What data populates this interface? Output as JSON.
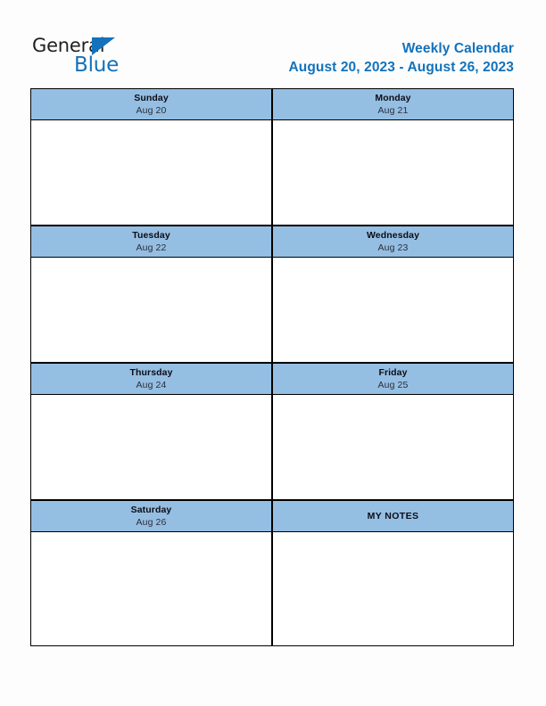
{
  "logo": {
    "word_dark": "General",
    "word_blue": "Blue",
    "triangle_icon": "triangle-icon",
    "brand_color": "#1372bb",
    "dark_color": "#231f20"
  },
  "header": {
    "title": "Weekly Calendar",
    "date_range": "August 20, 2023 - August 26, 2023",
    "title_color": "#1372bb"
  },
  "calendar": {
    "header_bg_color": "#95bee3",
    "border_color": "#000000",
    "cell_bg_color": "#ffffff",
    "rows": [
      {
        "left": {
          "day": "Sunday",
          "date": "Aug 20"
        },
        "right": {
          "day": "Monday",
          "date": "Aug 21"
        }
      },
      {
        "left": {
          "day": "Tuesday",
          "date": "Aug 22"
        },
        "right": {
          "day": "Wednesday",
          "date": "Aug 23"
        }
      },
      {
        "left": {
          "day": "Thursday",
          "date": "Aug 24"
        },
        "right": {
          "day": "Friday",
          "date": "Aug 25"
        }
      },
      {
        "left": {
          "day": "Saturday",
          "date": "Aug 26"
        },
        "right": {
          "day": "MY NOTES",
          "date": ""
        }
      }
    ]
  }
}
